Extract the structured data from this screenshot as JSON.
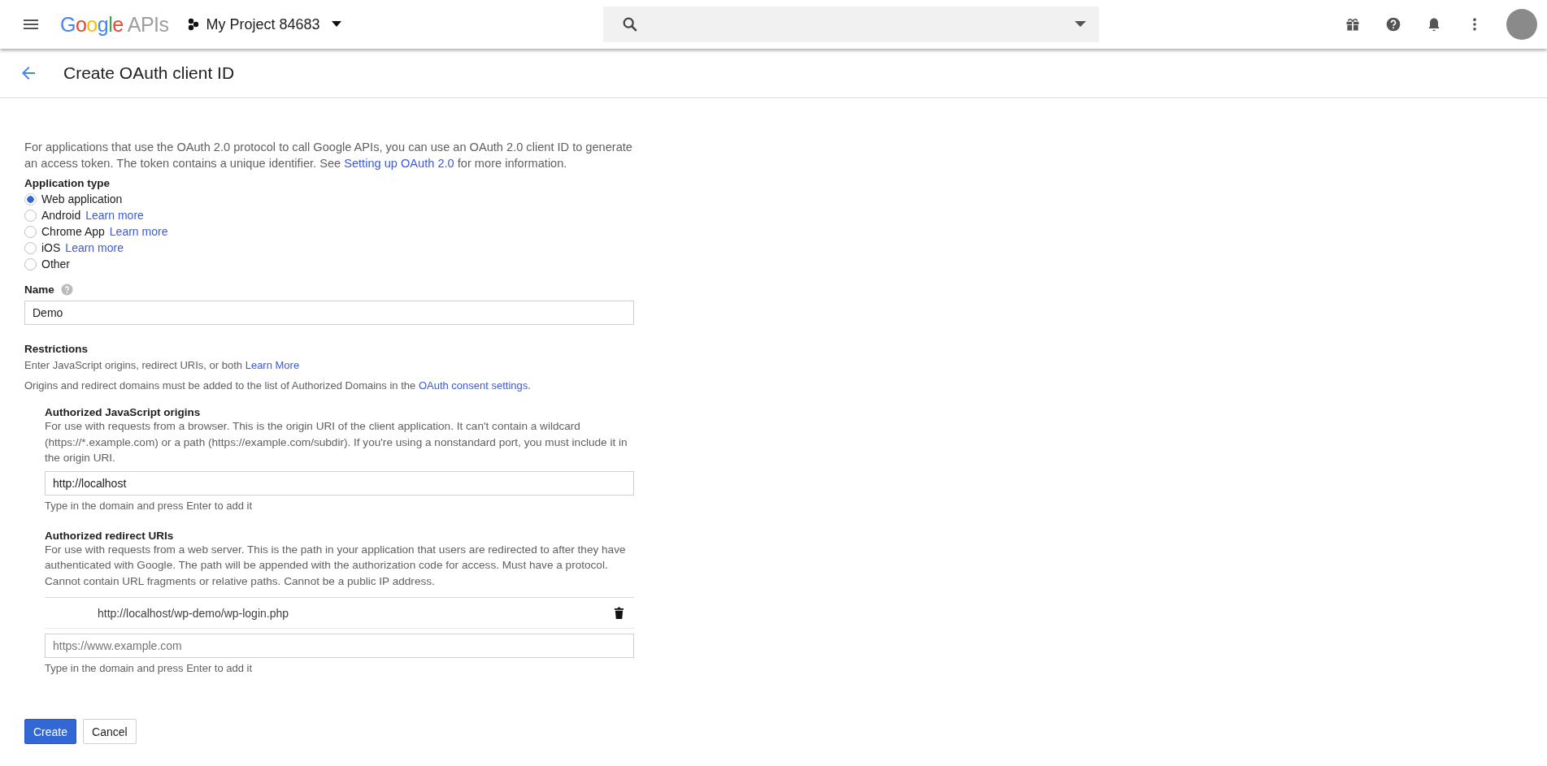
{
  "header": {
    "logo": {
      "brand": "Google",
      "product": "APIs"
    },
    "project": "My Project 84683"
  },
  "page_title": "Create OAuth client ID",
  "intro": {
    "text": "For applications that use the OAuth 2.0 protocol to call Google APIs, you can use an OAuth 2.0 client ID to generate an access token. The token contains a unique identifier. See ",
    "link": "Setting up OAuth 2.0",
    "after": " for more information."
  },
  "application_type": {
    "label": "Application type",
    "options": [
      {
        "label": "Web application",
        "selected": true
      },
      {
        "label": "Android",
        "link": "Learn more",
        "selected": false
      },
      {
        "label": "Chrome App",
        "link": "Learn more",
        "selected": false
      },
      {
        "label": "iOS",
        "link": "Learn more",
        "selected": false
      },
      {
        "label": "Other",
        "selected": false
      }
    ]
  },
  "name_field": {
    "label": "Name",
    "value": "Demo"
  },
  "restrictions": {
    "title": "Restrictions",
    "notes": [
      {
        "text": "Enter JavaScript origins, redirect URIs, or both ",
        "link": "Learn More"
      },
      {
        "text": "Origins and redirect domains must be added to the list of Authorized Domains in the ",
        "link": "OAuth consent settings",
        "after": "."
      }
    ],
    "sections": [
      {
        "title": "Authorized JavaScript origins",
        "description": "For use with requests from a browser. This is the origin URI of the client application. It can't contain a wildcard (https://*.example.com) or a path (https://example.com/subdir). If you're using a nonstandard port, you must include it in the origin URI.",
        "input": {
          "value": "http://localhost"
        },
        "hint": "Type in the domain and press Enter to add it"
      },
      {
        "title": "Authorized redirect URIs",
        "description": "For use with requests from a web server. This is the path in your application that users are redirected to after they have authenticated with Google. The path will be appended with the authorization code for access. Must have a protocol. Cannot contain URL fragments or relative paths. Cannot be a public IP address.",
        "entries": [
          "http://localhost/wp-demo/wp-login.php"
        ],
        "input": {
          "placeholder": "https://www.example.com"
        },
        "hint": "Type in the domain and press Enter to add it"
      }
    ]
  },
  "buttons": [
    {
      "label": "Create",
      "kind": "primary"
    },
    {
      "label": "Cancel",
      "kind": "secondary"
    }
  ]
}
